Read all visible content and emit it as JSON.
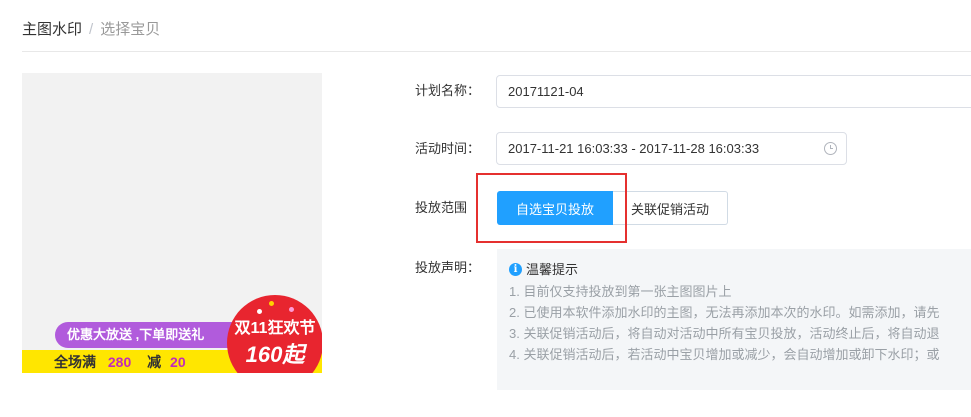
{
  "breadcrumb": {
    "root": "主图水印",
    "separator": "/",
    "current": "选择宝贝"
  },
  "preview": {
    "promo_text": "优惠大放送 ,下单即送礼",
    "full_label": "全场满",
    "full_amount": "280",
    "minus_label": "减",
    "minus_amount": "20",
    "badge_title": "双11狂欢节",
    "badge_price": "160起"
  },
  "form": {
    "plan_name_label": "计划名称：",
    "plan_name_value": "20171121-04",
    "activity_time_label": "活动时间：",
    "activity_time_value": "2017-11-21 16:03:33 - 2017-11-28 16:03:33",
    "scope_label": "投放范围",
    "scope_options": [
      "自选宝贝投放",
      "关联促销活动"
    ],
    "scope_selected": "自选宝贝投放",
    "statement_label": "投放声明："
  },
  "notice": {
    "title": "温馨提示",
    "items": [
      "1. 目前仅支持投放到第一张主图图片上",
      "2. 已使用本软件添加水印的主图，无法再添加本次的水印。如需添加，请先",
      "3. 关联促销活动后，将自动对活动中所有宝贝投放，活动终止后，将自动退",
      "4. 关联促销活动后，若活动中宝贝增加或减少，会自动增加或卸下水印；或"
    ]
  },
  "colors": {
    "primary": "#20a0ff",
    "highlight_border": "#e5302f",
    "promo_purple": "#b15bdc",
    "promo_yellow": "#ffe600",
    "badge_red": "#e8252f"
  }
}
